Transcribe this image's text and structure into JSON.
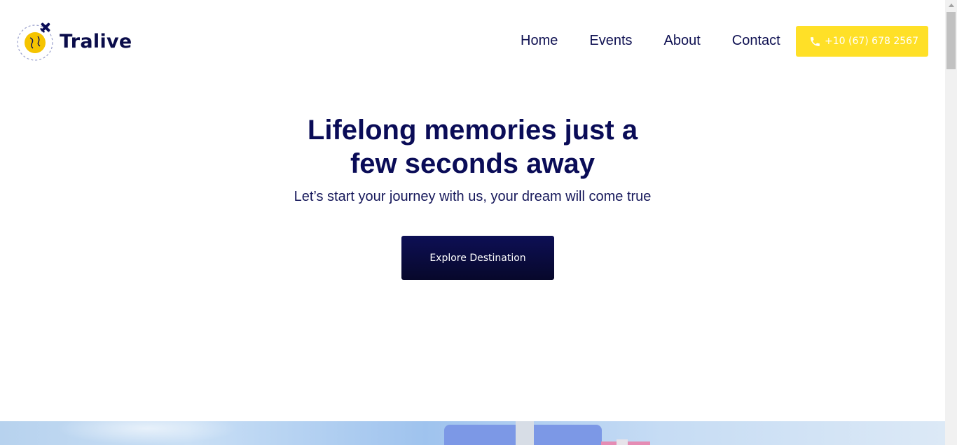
{
  "brand": {
    "name": "Tralive",
    "logo_icon": "globe-plane-icon",
    "colors": {
      "primary": "#0a0c57",
      "accent": "#ffe027",
      "logo_globe": "#f5c400"
    }
  },
  "nav": {
    "items": [
      {
        "label": "Home"
      },
      {
        "label": "Events"
      },
      {
        "label": "About"
      },
      {
        "label": "Contact"
      }
    ]
  },
  "phone": {
    "label": "+10 (67) 678 2567",
    "icon": "phone-icon"
  },
  "hero": {
    "title_line1": "Lifelong memories just a",
    "title_line2": "few seconds away",
    "subtitle": "Let’s start your journey with us, your dream will come true",
    "cta_label": "Explore Destination"
  }
}
